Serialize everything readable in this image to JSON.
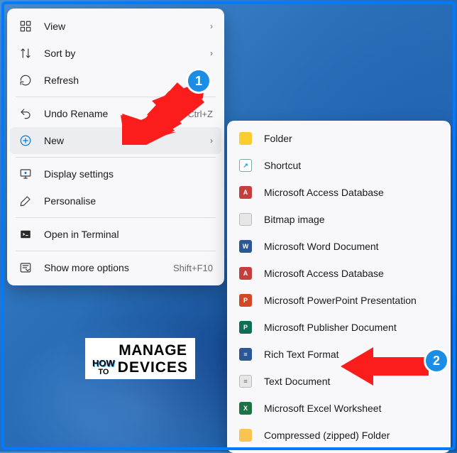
{
  "context_menu": {
    "items": [
      {
        "label": "View",
        "icon": "grid",
        "hasSubmenu": true
      },
      {
        "label": "Sort by",
        "icon": "sort",
        "hasSubmenu": true
      },
      {
        "label": "Refresh",
        "icon": "refresh"
      },
      {
        "sep": true
      },
      {
        "label": "Undo Rename",
        "icon": "undo",
        "shortcut": "Ctrl+Z"
      },
      {
        "label": "New",
        "icon": "new",
        "hasSubmenu": true,
        "hovered": true
      },
      {
        "sep": true
      },
      {
        "label": "Display settings",
        "icon": "display"
      },
      {
        "label": "Personalise",
        "icon": "brush"
      },
      {
        "sep": true
      },
      {
        "label": "Open in Terminal",
        "icon": "terminal"
      },
      {
        "sep": true
      },
      {
        "label": "Show more options",
        "icon": "more",
        "shortcut": "Shift+F10"
      }
    ]
  },
  "submenu": {
    "items": [
      {
        "label": "Folder",
        "tile": "folder",
        "glyph": ""
      },
      {
        "label": "Shortcut",
        "tile": "shortcut",
        "glyph": "↗"
      },
      {
        "label": "Microsoft Access Database",
        "tile": "red",
        "glyph": "A"
      },
      {
        "label": "Bitmap image",
        "tile": "gray",
        "glyph": ""
      },
      {
        "label": "Microsoft Word Document",
        "tile": "blue",
        "glyph": "W"
      },
      {
        "label": "Microsoft Access Database",
        "tile": "red",
        "glyph": "A"
      },
      {
        "label": "Microsoft PowerPoint Presentation",
        "tile": "orange",
        "glyph": "P"
      },
      {
        "label": "Microsoft Publisher Document",
        "tile": "teal",
        "glyph": "P"
      },
      {
        "label": "Rich Text Format",
        "tile": "blue",
        "glyph": "≡"
      },
      {
        "label": "Text Document",
        "tile": "gray",
        "glyph": "≡"
      },
      {
        "label": "Microsoft Excel Worksheet",
        "tile": "green",
        "glyph": "X"
      },
      {
        "label": "Compressed (zipped) Folder",
        "tile": "zip",
        "glyph": ""
      }
    ]
  },
  "annotations": {
    "step1": "1",
    "step2": "2"
  },
  "logo": {
    "line1a": "HOW",
    "line1b": "MANAGE",
    "line2a": "TO",
    "line2b": "DEVICES"
  }
}
